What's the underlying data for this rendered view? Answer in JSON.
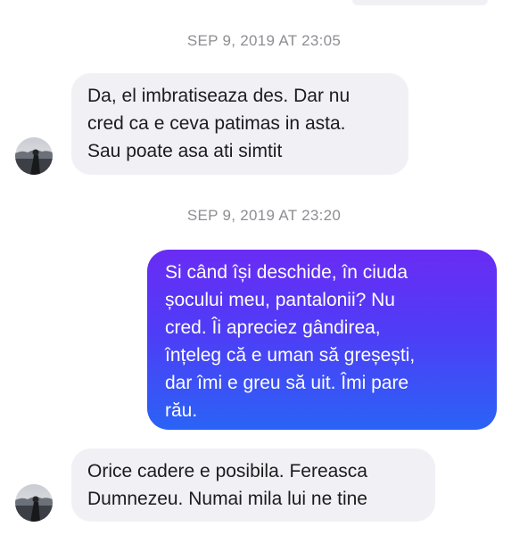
{
  "thread": {
    "timestamps": [
      "SEP 9, 2019 AT 23:05",
      "SEP 9, 2019 AT 23:20"
    ],
    "messages": [
      {
        "direction": "incoming",
        "lines": [
          "Da, el imbratiseaza des. Dar nu",
          "cred ca e ceva patimas in asta.",
          "Sau poate asa ati simtit"
        ]
      },
      {
        "direction": "outgoing",
        "lines": [
          "Si când își deschide, în ciuda",
          "șocului meu, pantalonii? Nu",
          "cred. Îi apreciez gândirea,",
          "înțeleg că e uman să greșești,",
          "dar îmi e greu să uit. Îmi pare",
          "rău."
        ]
      },
      {
        "direction": "incoming",
        "lines": [
          "Orice cadere e posibila. Fereasca",
          "Dumnezeu. Numai mila lui ne tine"
        ]
      }
    ]
  },
  "colors": {
    "incoming_bubble": "#f1f0f5",
    "outgoing_gradient_top": "#6a2cf4",
    "outgoing_gradient_bottom": "#2a63f6",
    "timestamp_text": "#8e8e93"
  },
  "icons": {
    "avatar": "contact-avatar-photo"
  }
}
